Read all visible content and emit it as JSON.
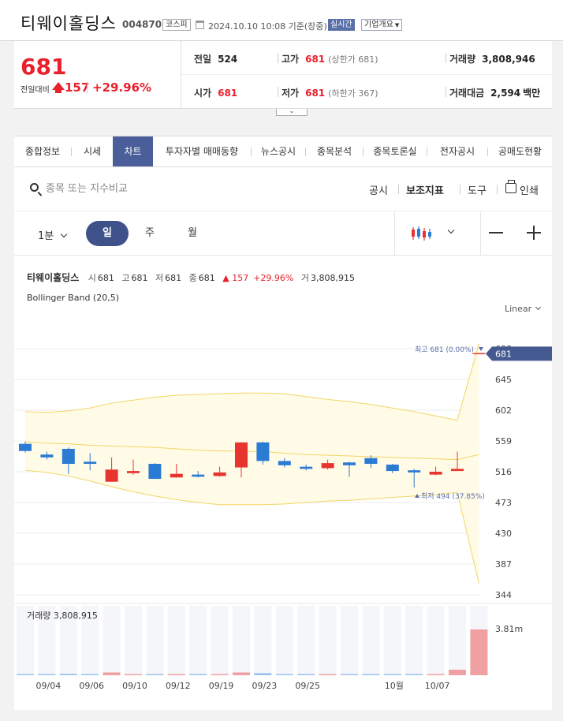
{
  "header": {
    "company_name": "티웨이홀딩스",
    "stock_code": "004870",
    "market": "코스피",
    "datetime": "2024.10.10 10:08 기준(장중)",
    "realtime_label": "실시간",
    "company_info_label": "기업개요"
  },
  "price": {
    "current": "681",
    "change_label": "전일대비",
    "change_abs": "157",
    "change_pct": "+29.96%",
    "prev_close_label": "전일",
    "prev_close": "524",
    "high_label": "고가",
    "high": "681",
    "high_sub": "(상한가 681)",
    "volume_label": "거래량",
    "volume": "3,808,946",
    "open_label": "시가",
    "open": "681",
    "low_label": "저가",
    "low": "681",
    "low_sub": "(하한가 367)",
    "amount_label": "거래대금",
    "amount": "2,594",
    "amount_unit": "백만"
  },
  "tabs": [
    {
      "label": "종합정보"
    },
    {
      "label": "시세"
    },
    {
      "label": "차트"
    },
    {
      "label": "투자자별 매매동향"
    },
    {
      "label": "뉴스공시"
    },
    {
      "label": "종목분석"
    },
    {
      "label": "종목토론실"
    },
    {
      "label": "전자공시"
    },
    {
      "label": "공매도현황"
    }
  ],
  "toolbar": {
    "search_placeholder": "종목 또는 지수비교",
    "disclosure": "공시",
    "indicators": "보조지표",
    "tools": "도구",
    "print": "인쇄"
  },
  "periodbar": {
    "interval": "1분",
    "periods": [
      "일",
      "주",
      "월"
    ],
    "active_period": "일"
  },
  "chart_info": {
    "name": "티웨이홀딩스",
    "open_label": "시",
    "open": "681",
    "high_label": "고",
    "high": "681",
    "low_label": "저",
    "low": "681",
    "close_label": "종",
    "close": "681",
    "change": "157",
    "change_pct": "+29.96%",
    "volume_label": "거",
    "volume": "3,808,915",
    "indicator": "Bollinger Band (20,5)",
    "scale": "Linear"
  },
  "chart_data": {
    "type": "candlestick",
    "y_ticks": [
      688,
      645,
      602,
      559,
      516,
      473,
      430,
      387,
      344
    ],
    "ylim": [
      344,
      688
    ],
    "current_price_label": "681",
    "max_annotation": {
      "label": "최고",
      "value": "681",
      "pct": "(0.00%)"
    },
    "min_annotation": {
      "label": "최저",
      "value": "494",
      "pct": "(37.85%)"
    },
    "x_labels": [
      {
        "i": 1,
        "label": "09/04"
      },
      {
        "i": 3,
        "label": "09/06"
      },
      {
        "i": 5,
        "label": "09/10"
      },
      {
        "i": 7,
        "label": "09/12"
      },
      {
        "i": 9,
        "label": "09/19"
      },
      {
        "i": 11,
        "label": "09/23"
      },
      {
        "i": 13,
        "label": "09/25"
      },
      {
        "i": 17,
        "label": "10월"
      },
      {
        "i": 19,
        "label": "10/07"
      }
    ],
    "candles": [
      {
        "o": 555,
        "c": 545,
        "h": 558,
        "l": 543,
        "vol": 0.01
      },
      {
        "o": 540,
        "c": 536,
        "h": 544,
        "l": 533,
        "vol": 0.01
      },
      {
        "o": 548,
        "c": 527,
        "h": 550,
        "l": 513,
        "vol": 0.02
      },
      {
        "o": 530,
        "c": 527,
        "h": 542,
        "l": 518,
        "vol": 0.01
      },
      {
        "o": 502,
        "c": 519,
        "h": 536,
        "l": 502,
        "vol": 0.04
      },
      {
        "o": 514,
        "c": 517,
        "h": 533,
        "l": 512,
        "vol": 0.01
      },
      {
        "o": 527,
        "c": 506,
        "h": 528,
        "l": 506,
        "vol": 0.01
      },
      {
        "o": 508,
        "c": 513,
        "h": 527,
        "l": 508,
        "vol": 0.01
      },
      {
        "o": 512,
        "c": 509,
        "h": 517,
        "l": 508,
        "vol": 0.01
      },
      {
        "o": 510,
        "c": 515,
        "h": 523,
        "l": 509,
        "vol": 0.01
      },
      {
        "o": 522,
        "c": 557,
        "h": 557,
        "l": 508,
        "vol": 0.04
      },
      {
        "o": 557,
        "c": 531,
        "h": 558,
        "l": 526,
        "vol": 0.03
      },
      {
        "o": 531,
        "c": 525,
        "h": 535,
        "l": 522,
        "vol": 0.01
      },
      {
        "o": 523,
        "c": 520,
        "h": 526,
        "l": 518,
        "vol": 0.01
      },
      {
        "o": 521,
        "c": 528,
        "h": 533,
        "l": 519,
        "vol": 0.01
      },
      {
        "o": 529,
        "c": 525,
        "h": 530,
        "l": 509,
        "vol": 0.01
      },
      {
        "o": 535,
        "c": 527,
        "h": 539,
        "l": 521,
        "vol": 0.01
      },
      {
        "o": 526,
        "c": 517,
        "h": 527,
        "l": 514,
        "vol": 0.01
      },
      {
        "o": 518,
        "c": 515,
        "h": 520,
        "l": 494,
        "vol": 0.01
      },
      {
        "o": 512,
        "c": 516,
        "h": 523,
        "l": 511,
        "vol": 0.01
      },
      {
        "o": 517,
        "c": 520,
        "h": 544,
        "l": 517,
        "vol": 0.08
      },
      {
        "o": 681,
        "c": 681,
        "h": 681,
        "l": 681,
        "vol": 0.66
      }
    ],
    "bollinger": {
      "upper": [
        600,
        599,
        601,
        605,
        612,
        616,
        620,
        623,
        624,
        625,
        626,
        626,
        625,
        621,
        617,
        614,
        610,
        605,
        600,
        594,
        588,
        695
      ],
      "middle": [
        558,
        556,
        555,
        553,
        552,
        551,
        550,
        548,
        546,
        545,
        545,
        544,
        542,
        540,
        539,
        538,
        537,
        536,
        535,
        534,
        533,
        540
      ],
      "lower": [
        518,
        515,
        510,
        503,
        495,
        488,
        482,
        477,
        473,
        470,
        470,
        470,
        471,
        473,
        475,
        476,
        478,
        480,
        482,
        484,
        487,
        360
      ]
    },
    "volume_label": "거래량",
    "volume_value": "3,808,915",
    "volume_axis_label": "3.81m"
  },
  "colors": {
    "up": "#e8342f",
    "down": "#2b7bd3",
    "accent": "#4a5f99",
    "band_fill": "#fffbe6",
    "band_line": "#f2d565",
    "volume_up": "#f0a0a0",
    "volume_bar_bg": "#f4f6fa"
  }
}
